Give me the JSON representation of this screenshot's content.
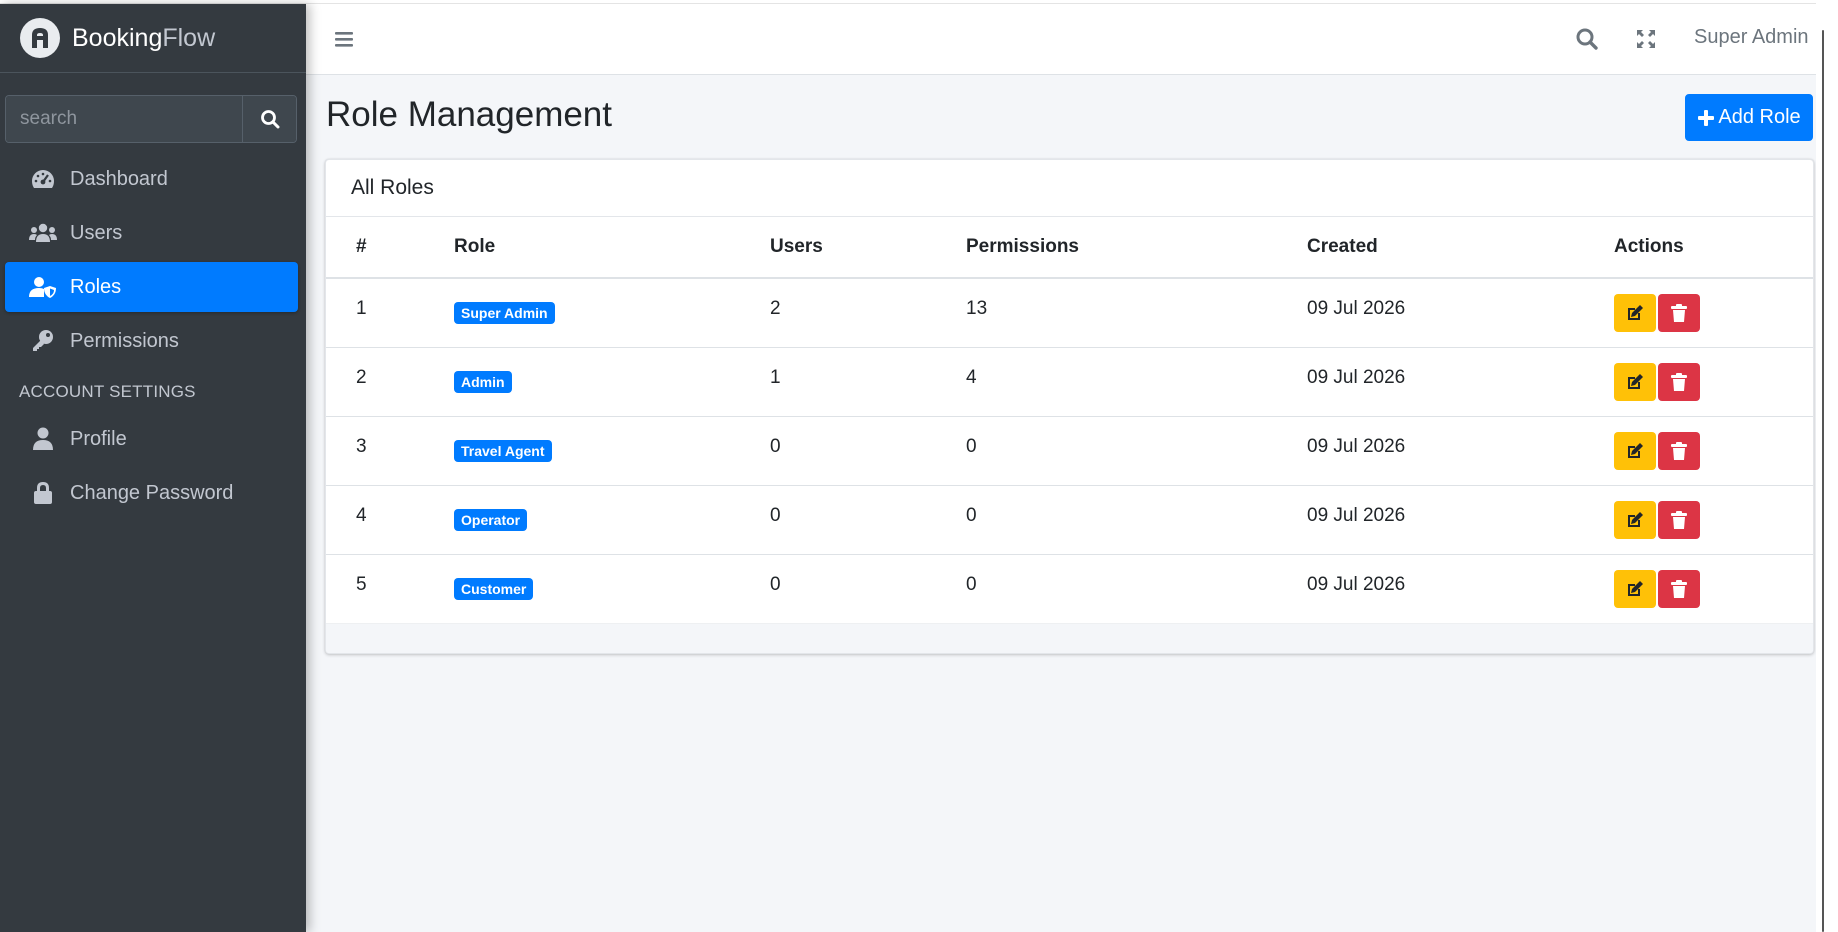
{
  "brand": {
    "name_bold": "Booking",
    "name_light": "Flow"
  },
  "sidebar": {
    "search_placeholder": "search",
    "items": [
      {
        "label": "Dashboard",
        "icon": "tachometer-icon",
        "active": false
      },
      {
        "label": "Users",
        "icon": "users-icon",
        "active": false
      },
      {
        "label": "Roles",
        "icon": "user-shield-icon",
        "active": true
      },
      {
        "label": "Permissions",
        "icon": "key-icon",
        "active": false
      }
    ],
    "section_header": "ACCOUNT SETTINGS",
    "account_items": [
      {
        "label": "Profile",
        "icon": "user-icon"
      },
      {
        "label": "Change Password",
        "icon": "lock-icon"
      }
    ]
  },
  "topbar": {
    "user_label": "Super Admin"
  },
  "page": {
    "title": "Role Management",
    "add_button_label": "Add Role"
  },
  "table": {
    "card_title": "All Roles",
    "columns": [
      "#",
      "Role",
      "Users",
      "Permissions",
      "Created",
      "Actions"
    ],
    "rows": [
      {
        "num": "1",
        "role": "Super Admin",
        "users": "2",
        "permissions": "13",
        "created": "09 Jul 2026"
      },
      {
        "num": "2",
        "role": "Admin",
        "users": "1",
        "permissions": "4",
        "created": "09 Jul 2026"
      },
      {
        "num": "3",
        "role": "Travel Agent",
        "users": "0",
        "permissions": "0",
        "created": "09 Jul 2026"
      },
      {
        "num": "4",
        "role": "Operator",
        "users": "0",
        "permissions": "0",
        "created": "09 Jul 2026"
      },
      {
        "num": "5",
        "role": "Customer",
        "users": "0",
        "permissions": "0",
        "created": "09 Jul 2026"
      }
    ]
  },
  "colors": {
    "sidebar_bg": "#343a40",
    "accent": "#007bff",
    "edit_button": "#ffc107",
    "delete_button": "#dc3545",
    "content_bg": "#f4f6f9"
  }
}
